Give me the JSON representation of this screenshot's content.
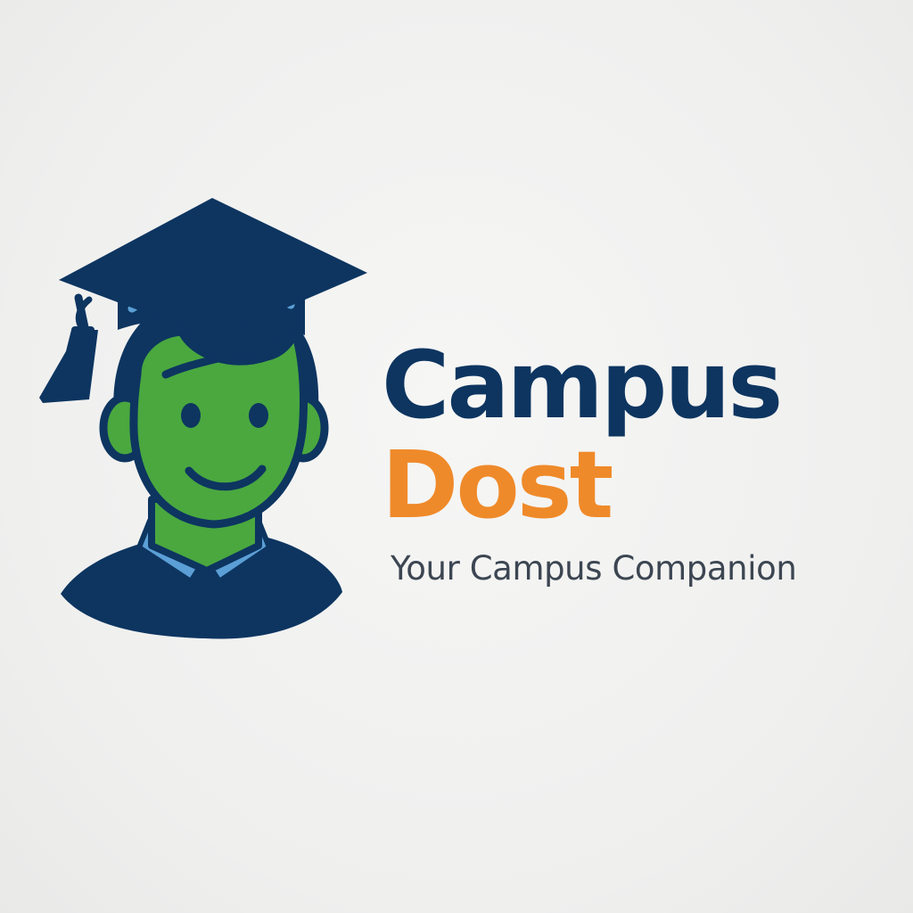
{
  "logo": {
    "name_line1": "Campus",
    "name_line2": "Dost",
    "tagline": "Your Campus Companion"
  },
  "colors": {
    "navy": "#0d3560",
    "orange": "#ef8a2a",
    "green": "#4aa83f",
    "light_blue": "#5b9fd6",
    "tagline_gray": "#3c4652",
    "background": "#f1f1f0"
  },
  "icons": {
    "mascot": "graduate-student-icon",
    "cap": "graduation-cap-icon"
  }
}
